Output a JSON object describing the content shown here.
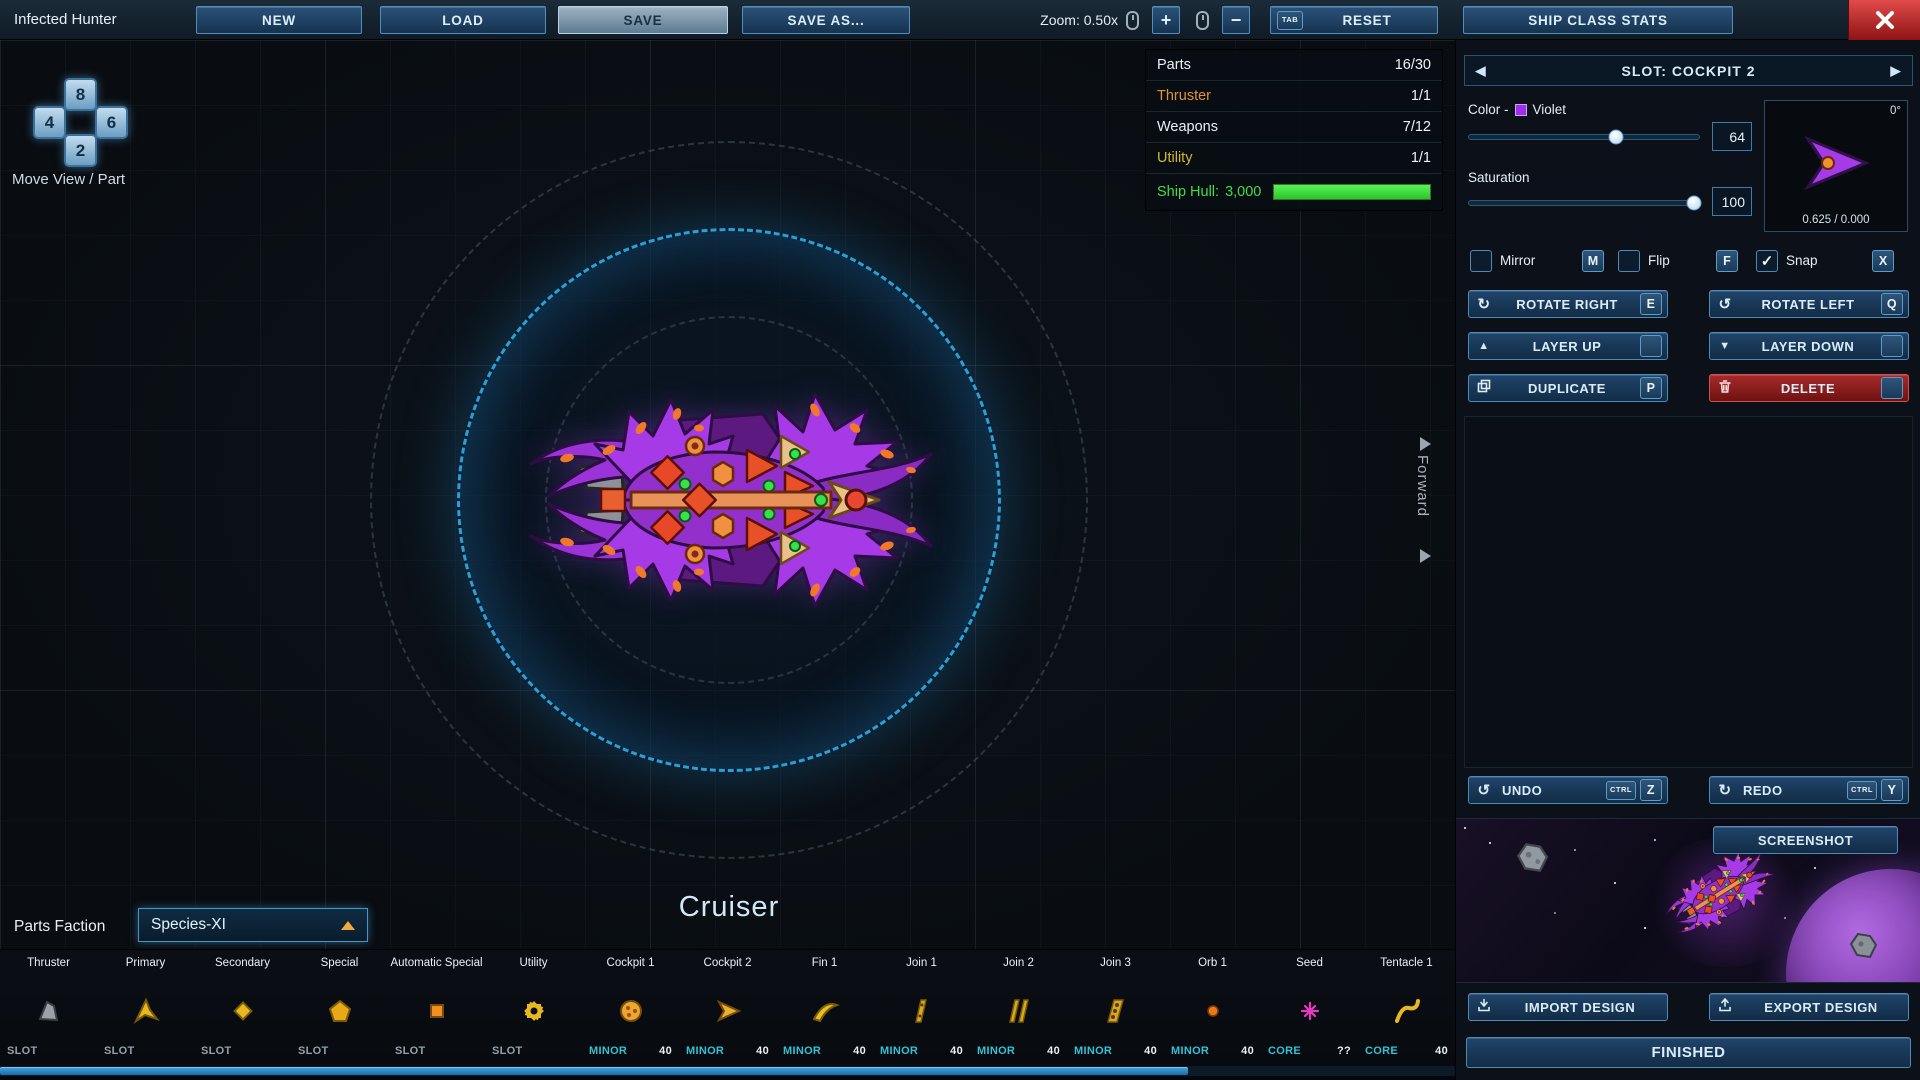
{
  "colors": {
    "accent_blue": "#4f8fc0",
    "violet": "#9b30e8",
    "orange": "#e0923a",
    "green": "#42dd48",
    "red": "#c0392b"
  },
  "icons": {
    "prev": "◀",
    "next": "▶",
    "rotate_cw": "↻",
    "rotate_ccw": "↺",
    "layer_up": "▲",
    "layer_down": "▼",
    "check": "✓"
  },
  "top_bar": {
    "ship_name": "Infected Hunter",
    "new": "NEW",
    "load": "LOAD",
    "save": "SAVE",
    "save_as": "SAVE AS...",
    "zoom": "Zoom: 0.50x",
    "plus": "+",
    "minus": "−",
    "tab_key": "TAB",
    "reset": "RESET",
    "ship_class_stats": "SHIP CLASS STATS"
  },
  "move_pad": {
    "up": "8",
    "left": "4",
    "right": "6",
    "down": "2",
    "label": "Move View / Part"
  },
  "stats": {
    "rows": [
      {
        "label": "Parts",
        "value": "16/30"
      },
      {
        "label": "Thruster",
        "value": "1/1"
      },
      {
        "label": "Weapons",
        "value": "7/12"
      },
      {
        "label": "Utility",
        "value": "1/1"
      }
    ],
    "hull_label": "Ship Hull:",
    "hull_value": "3,000"
  },
  "canvas": {
    "ship_class": "Cruiser",
    "forward": "Forward"
  },
  "slot_panel": {
    "title": "SLOT: COCKPIT 2",
    "color_label": "Color -",
    "color_name": "Violet",
    "color_value": "64",
    "saturation_label": "Saturation",
    "saturation_value": "100",
    "angle": "0°",
    "position": "0.625 / 0.000",
    "mirror": "Mirror",
    "mirror_key": "M",
    "flip": "Flip",
    "flip_key": "F",
    "snap": "Snap",
    "snap_key": "X",
    "rotate_right": "ROTATE RIGHT",
    "rotate_right_key": "E",
    "rotate_left": "ROTATE LEFT",
    "rotate_left_key": "Q",
    "layer_up": "LAYER UP",
    "layer_down": "LAYER DOWN",
    "duplicate": "DUPLICATE",
    "duplicate_key": "P",
    "delete": "DELETE",
    "undo": "UNDO",
    "undo_keys": [
      "CTRL",
      "Z"
    ],
    "redo": "REDO",
    "redo_keys": [
      "CTRL",
      "Y"
    ],
    "screenshot": "SCREENSHOT",
    "import_design": "IMPORT DESIGN",
    "export_design": "EXPORT DESIGN",
    "finished": "FINISHED"
  },
  "parts_bar": {
    "faction_label": "Parts Faction",
    "faction_value": "Species-XI",
    "parts": [
      {
        "name": "Thruster",
        "type": "SLOT",
        "cost": "",
        "icon": "thruster-icon"
      },
      {
        "name": "Primary",
        "type": "SLOT",
        "cost": "",
        "icon": "primary-icon"
      },
      {
        "name": "Secondary",
        "type": "SLOT",
        "cost": "",
        "icon": "secondary-icon"
      },
      {
        "name": "Special",
        "type": "SLOT",
        "cost": "",
        "icon": "special-icon"
      },
      {
        "name": "Automatic Special",
        "type": "SLOT",
        "cost": "",
        "icon": "automatic-special-icon"
      },
      {
        "name": "Utility",
        "type": "SLOT",
        "cost": "",
        "icon": "utility-icon"
      },
      {
        "name": "Cockpit 1",
        "type": "MINOR",
        "cost": "40",
        "icon": "cockpit-1-icon"
      },
      {
        "name": "Cockpit 2",
        "type": "MINOR",
        "cost": "40",
        "icon": "cockpit-2-icon"
      },
      {
        "name": "Fin 1",
        "type": "MINOR",
        "cost": "40",
        "icon": "fin-1-icon"
      },
      {
        "name": "Join 1",
        "type": "MINOR",
        "cost": "40",
        "icon": "join-1-icon"
      },
      {
        "name": "Join 2",
        "type": "MINOR",
        "cost": "40",
        "icon": "join-2-icon"
      },
      {
        "name": "Join 3",
        "type": "MINOR",
        "cost": "40",
        "icon": "join-3-icon"
      },
      {
        "name": "Orb 1",
        "type": "MINOR",
        "cost": "40",
        "icon": "orb-1-icon"
      },
      {
        "name": "Seed",
        "type": "CORE",
        "cost": "??",
        "icon": "seed-icon"
      },
      {
        "name": "Tentacle 1",
        "type": "CORE",
        "cost": "40",
        "icon": "tentacle-1-icon"
      }
    ]
  }
}
